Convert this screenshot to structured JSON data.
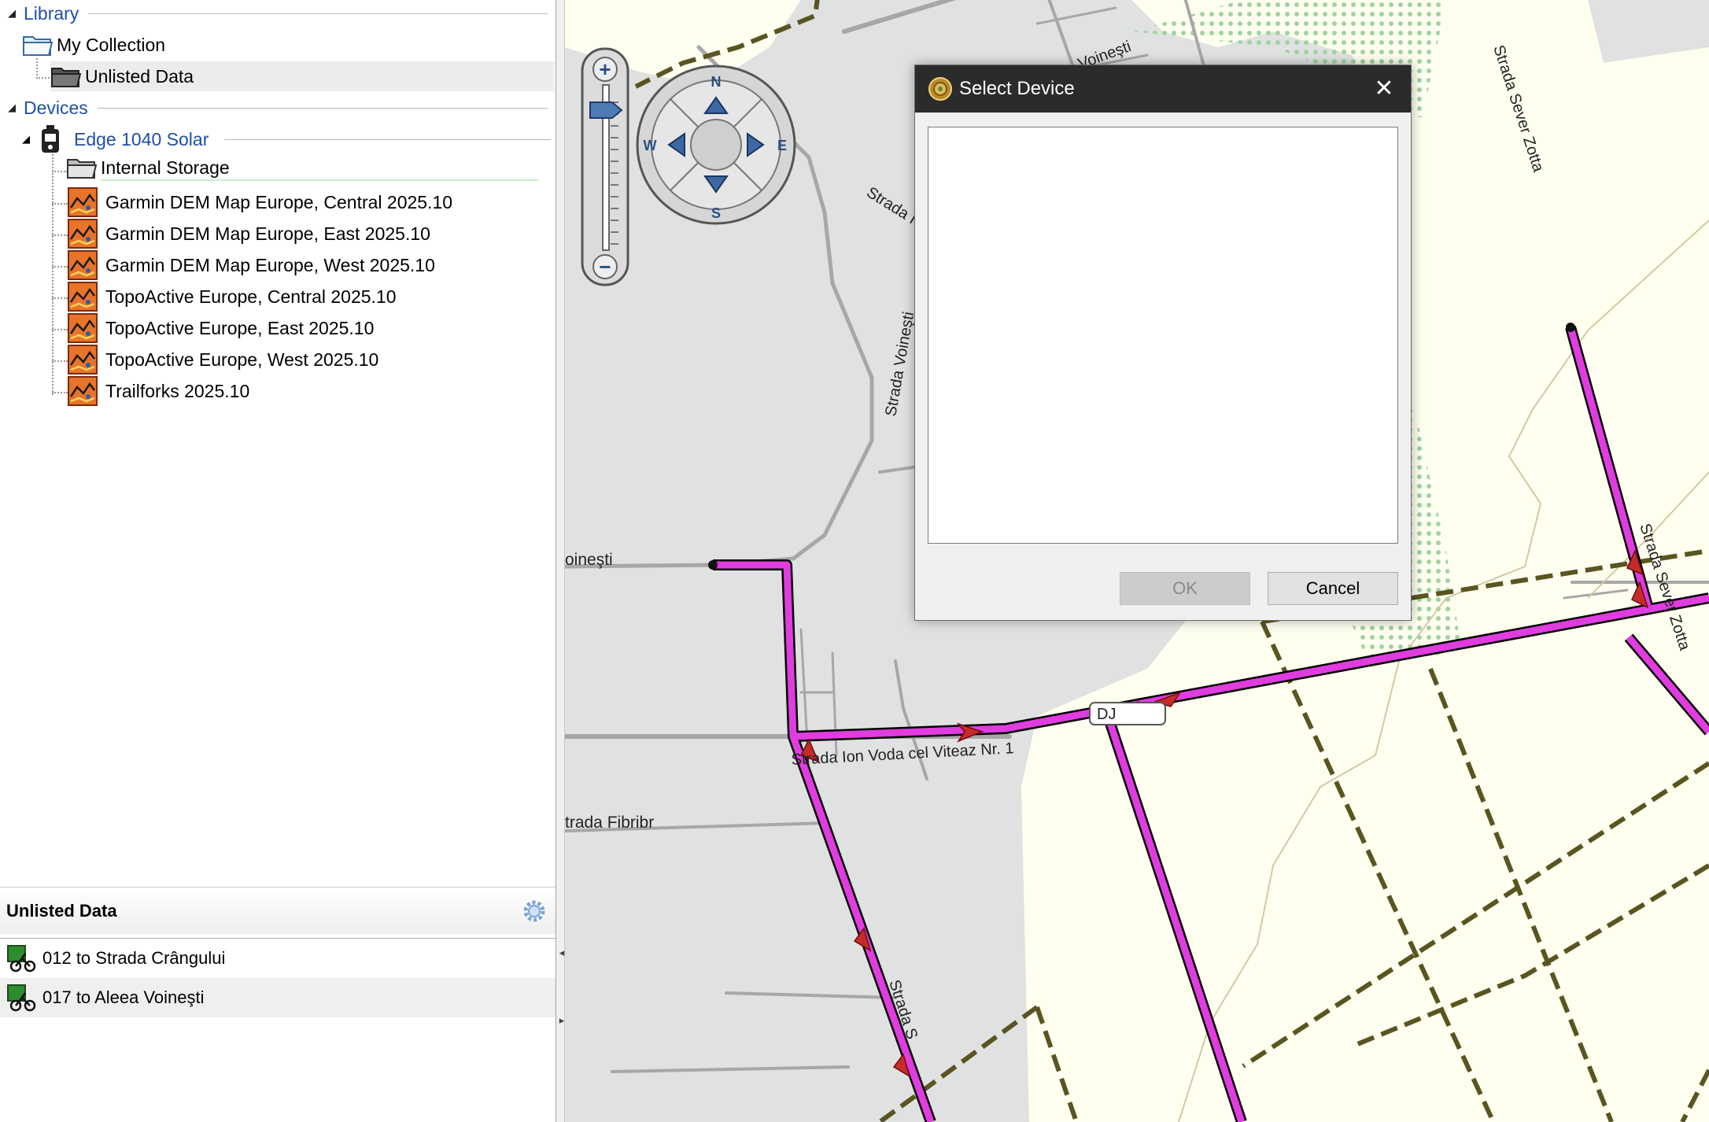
{
  "library": {
    "header": "Library",
    "items": [
      {
        "label": "My Collection"
      },
      {
        "label": "Unlisted Data"
      }
    ]
  },
  "devices": {
    "header": "Devices",
    "device_name": "Edge 1040 Solar",
    "storage_label": "Internal Storage",
    "maps": [
      "Garmin DEM Map Europe, Central 2025.10",
      "Garmin DEM Map Europe, East 2025.10",
      "Garmin DEM Map Europe, West 2025.10",
      "TopoActive Europe, Central 2025.10",
      "TopoActive Europe, East 2025.10",
      "TopoActive Europe, West 2025.10",
      "Trailforks 2025.10"
    ]
  },
  "bottom_panel": {
    "title": "Unlisted Data",
    "items": [
      {
        "label": "012 to Strada Crângului"
      },
      {
        "label": "017 to Aleea Voineşti"
      }
    ]
  },
  "map": {
    "compass": {
      "n": "N",
      "s": "S",
      "w": "W",
      "e": "E"
    },
    "zoom": {
      "plus": "+",
      "minus": "−"
    },
    "labels": {
      "voinesti_top": "Voineşti",
      "strada_top": "Strada I",
      "strada_voinesti": "Strada Voineşti",
      "voinesti_left": "oineşti",
      "ion_voda": "Strada Ion Voda cel Viteaz Nr. 1",
      "fibrior": "trada Fibribr",
      "sever_zotta_top": "Strada Sever Zotta",
      "sever_zotta_right": "Strada Sever Zotta",
      "strada_bottom": "Strada S",
      "road_badge": "DJ"
    },
    "route_color": "#e03ce0",
    "trail_color": "#5a5520"
  },
  "dialog": {
    "title": "Select Device",
    "ok_label": "OK",
    "cancel_label": "Cancel",
    "close_glyph": "✕"
  },
  "splitter": {
    "up_glyph": "◂",
    "down_glyph": "▸"
  }
}
